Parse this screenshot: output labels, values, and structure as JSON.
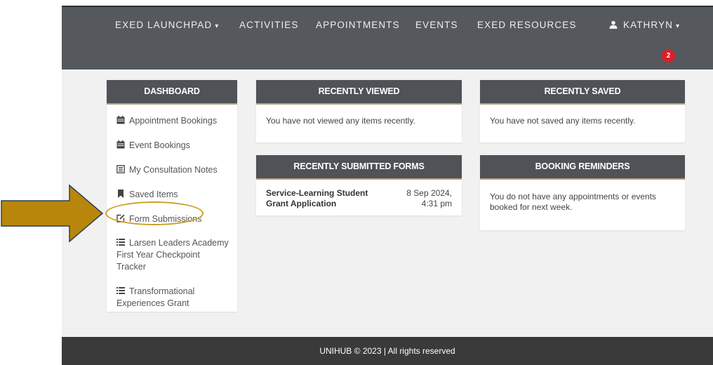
{
  "nav": {
    "items": [
      {
        "label": "EXED LAUNCHPAD",
        "caret": "▾"
      },
      {
        "label": "ACTIVITIES"
      },
      {
        "label": "APPOINTMENTS"
      },
      {
        "label": "EVENTS"
      },
      {
        "label": "EXED RESOURCES"
      },
      {
        "label": "KATHRYN",
        "caret": "▾",
        "icon": "user-icon"
      }
    ],
    "notification_count": "2"
  },
  "dashboard": {
    "title": "DASHBOARD",
    "items": [
      {
        "label": "Appointment Bookings",
        "icon": "calendar-icon"
      },
      {
        "label": "Event Bookings",
        "icon": "calendar-icon"
      },
      {
        "label": "My Consultation Notes",
        "icon": "notes-icon"
      },
      {
        "label": "Saved Items",
        "icon": "bookmark-icon"
      },
      {
        "label": "Form Submissions",
        "icon": "edit-icon"
      },
      {
        "label_line1": "Larsen Leaders Academy",
        "label_line2": "First Year Checkpoint",
        "label_line3": "Tracker",
        "icon": "list-icon"
      },
      {
        "label_line1": "Transformational",
        "label_line2": "Experiences Grant",
        "icon": "list-icon"
      }
    ]
  },
  "recently_viewed": {
    "title": "RECENTLY VIEWED",
    "message": "You have not viewed any items recently."
  },
  "recently_saved": {
    "title": "RECENTLY SAVED",
    "message": "You have not saved any items recently."
  },
  "recently_submitted": {
    "title": "RECENTLY SUBMITTED FORMS",
    "forms": [
      {
        "title_line1": "Service-Learning Student",
        "title_line2": "Grant Application",
        "date_line1": "8 Sep 2024,",
        "date_line2": "4:31 pm"
      }
    ]
  },
  "booking_reminders": {
    "title": "BOOKING REMINDERS",
    "message_line1": "You do not have any appointments or events",
    "message_line2": "booked for next week."
  },
  "footer": {
    "text": "UNIHUB © 2023 | All rights reserved"
  },
  "colors": {
    "nav_bg": "#55585c",
    "card_head": "#4f5256",
    "accent_gold": "#b3a37a",
    "arrow_gold": "#c9a227",
    "badge_red": "#d9202a"
  }
}
